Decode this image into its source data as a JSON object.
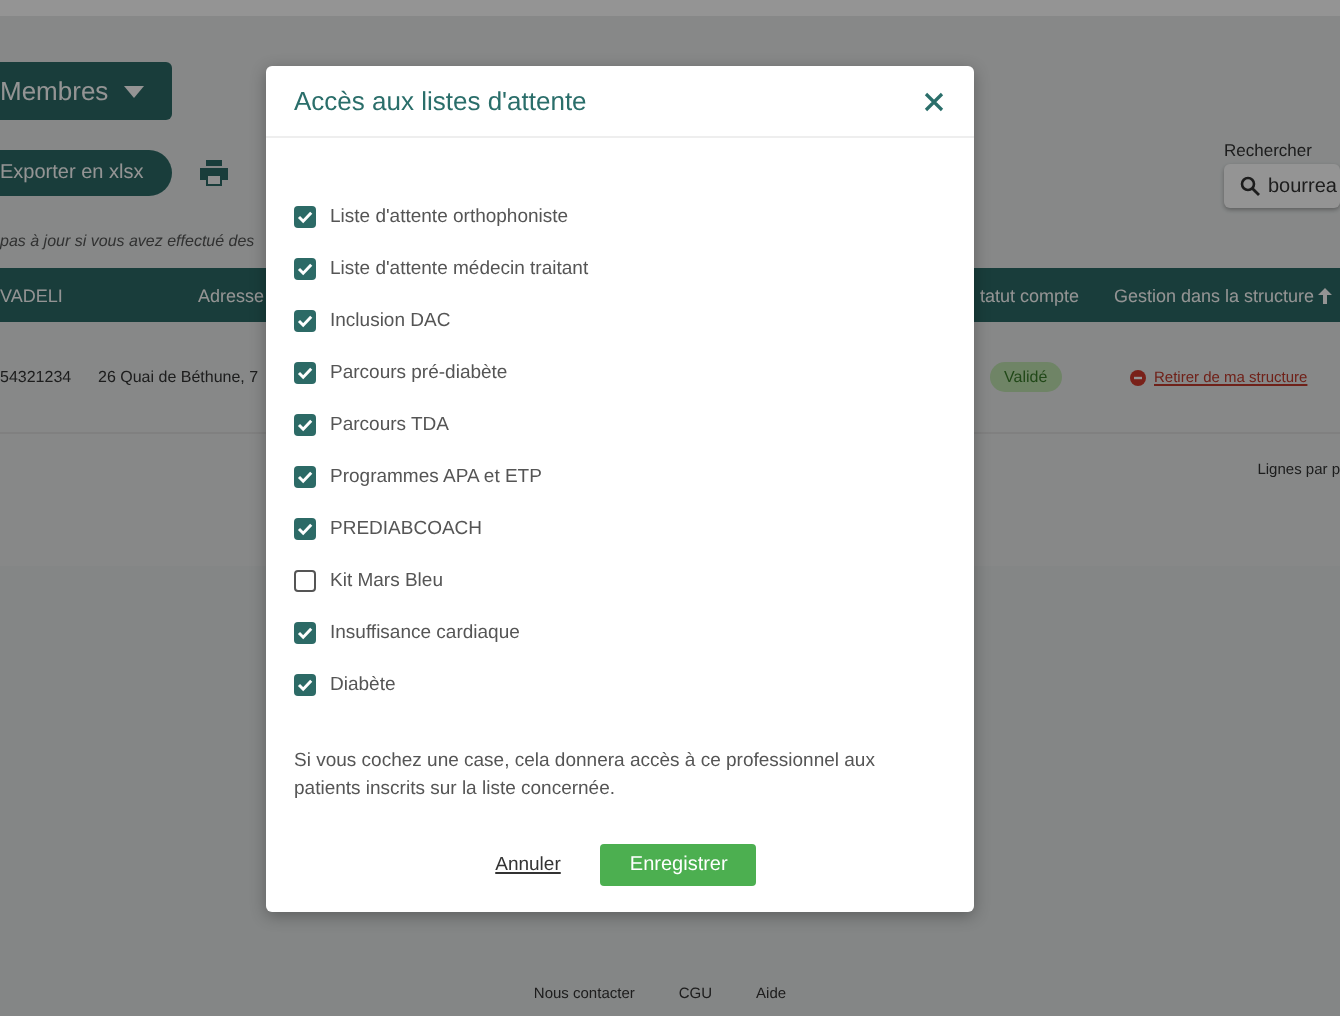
{
  "page": {
    "members_button": "Membres",
    "export_button": "Exporter en xlsx",
    "search": {
      "label": "Rechercher",
      "value": "bourrea"
    },
    "notice": "pas à jour si vous avez effectué des",
    "table": {
      "columns": [
        "VADELI",
        "Adresse",
        "tatut compte",
        "Gestion dans la structure"
      ],
      "rows": [
        {
          "cells": [
            "54321234",
            "26 Quai de Béthune, 7"
          ],
          "status": "Validé",
          "action": "Retirer de ma structure"
        }
      ]
    },
    "pagination_label": "Lignes par p"
  },
  "footer": [
    "Nous contacter",
    "CGU",
    "Aide"
  ],
  "dialog": {
    "title": "Accès aux listes d'attente",
    "items": [
      {
        "label": "Liste d'attente orthophoniste",
        "checked": true
      },
      {
        "label": "Liste d'attente médecin traitant",
        "checked": true
      },
      {
        "label": "Inclusion DAC",
        "checked": true
      },
      {
        "label": "Parcours pré-diabète",
        "checked": true
      },
      {
        "label": "Parcours TDA",
        "checked": true
      },
      {
        "label": "Programmes APA et ETP",
        "checked": true
      },
      {
        "label": "PREDIABCOACH",
        "checked": true
      },
      {
        "label": "Kit Mars Bleu",
        "checked": false
      },
      {
        "label": "Insuffisance cardiaque",
        "checked": true
      },
      {
        "label": "Diabète",
        "checked": true
      }
    ],
    "hint": "Si vous cochez une case, cela donnera accès à ce professionnel aux patients inscrits sur la liste concernée.",
    "cancel": "Annuler",
    "save": "Enregistrer"
  }
}
